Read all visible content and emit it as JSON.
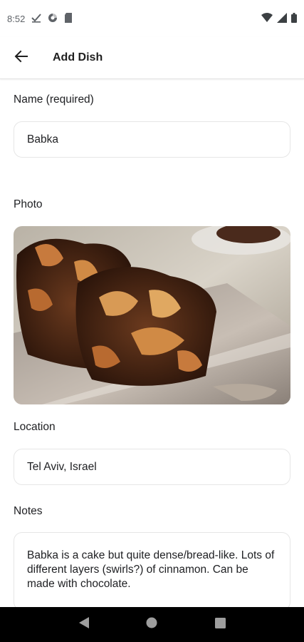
{
  "status_bar": {
    "time": "8:52",
    "icons_left": [
      "check-icon",
      "data-saver-icon",
      "sd-card-icon"
    ],
    "icons_right": [
      "wifi-icon",
      "signal-icon",
      "battery-icon"
    ]
  },
  "app_bar": {
    "title": "Add Dish",
    "back_icon": "arrow-back-icon"
  },
  "form": {
    "name": {
      "label": "Name (required)",
      "value": "Babka"
    },
    "photo": {
      "label": "Photo"
    },
    "location": {
      "label": "Location",
      "value": "Tel Aviv, Israel"
    },
    "notes": {
      "label": "Notes",
      "value": "Babka is a cake but quite dense/bread-like. Lots of different layers (swirls?) of cinnamon. Can be made with chocolate."
    }
  },
  "nav_bar": {
    "buttons": [
      "back-triangle-icon",
      "home-circle-icon",
      "recents-square-icon"
    ]
  },
  "colors": {
    "background": "#ffffff",
    "field_border": "#e6e6e6",
    "nav_bar": "#000000",
    "text": "#202124"
  }
}
